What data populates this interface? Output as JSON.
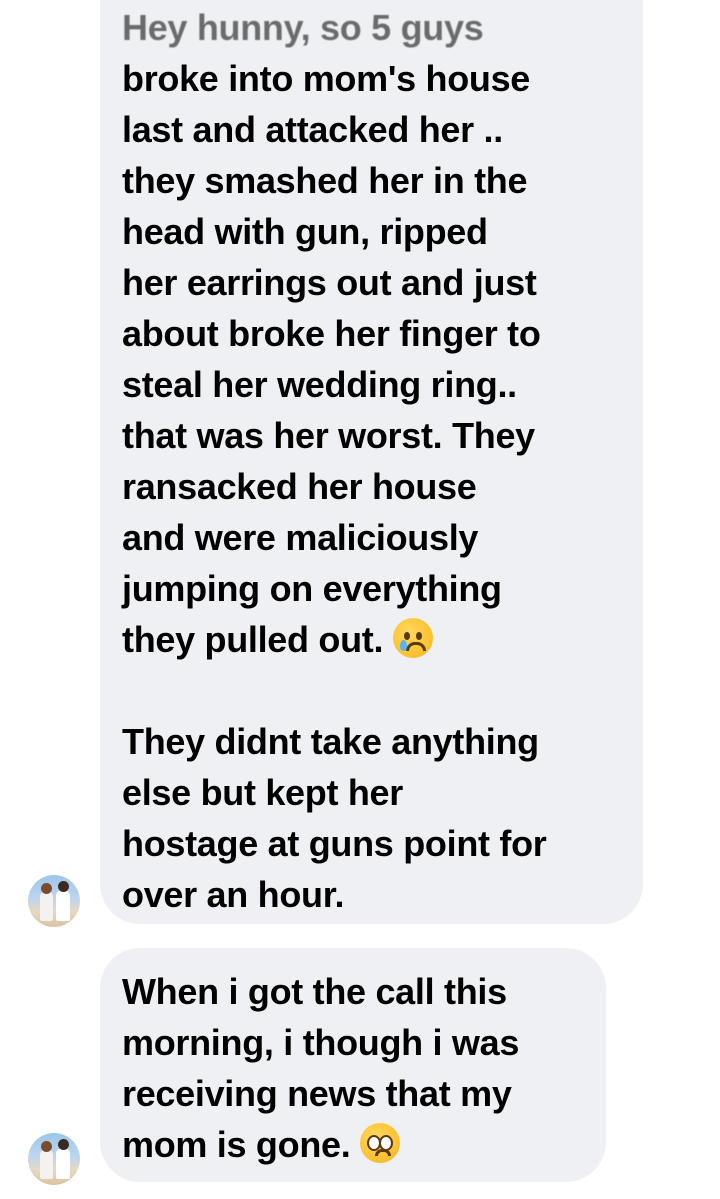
{
  "messages": [
    {
      "partial_line": "Hey hunny, so 5 guys",
      "paragraph_1": "broke into mom's house\nlast and attacked her ..\nthey smashed her in the\nhead with gun, ripped\nher earrings out and just\nabout broke her finger to\nsteal her wedding ring..\nthat was her worst. They\nransacked her house\nand were maliciously\njumping on everything\nthey pulled out.",
      "paragraph_1_emoji": "crying-face-emoji",
      "paragraph_2": "They didnt take anything\nelse but kept her\nhostage at guns point for\nover an hour."
    },
    {
      "text": "When i got the call this\nmorning,  i though i was\nreceiving news that my\nmom is gone.",
      "emoji": "pleading-face-emoji"
    }
  ],
  "colors": {
    "bubble_background": "#eef0f3",
    "text": "#000000",
    "page_background": "#ffffff"
  }
}
